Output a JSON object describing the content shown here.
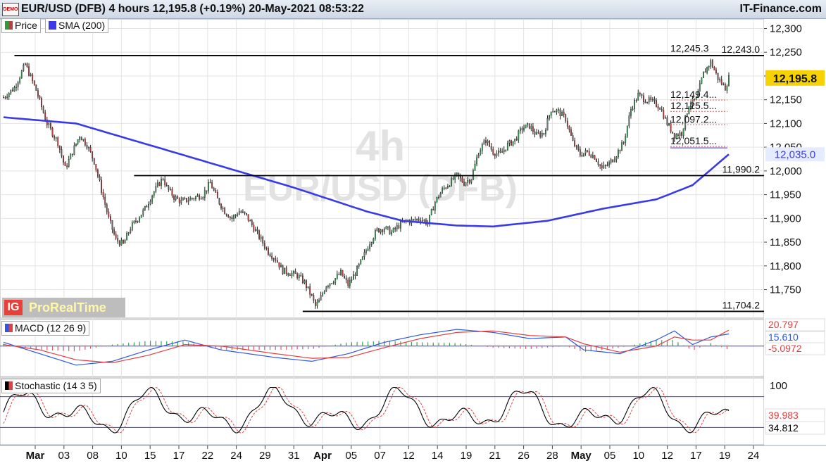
{
  "header": {
    "title": "EUR/USD (DFB) 4 hours 12,195.8 (+0.19%) 20-May-2021 08:53:22",
    "brand": "IT-Finance.com",
    "demo_icon_text": "DEMO"
  },
  "legend": {
    "price_label": "Price",
    "sma_label": "SMA (200)",
    "price_color": "#2e9e3a",
    "sma_color": "#3a3ae8"
  },
  "watermark": {
    "line1": "4h",
    "line2": "EUR/USD (DFB)"
  },
  "logo": {
    "ig": "IG",
    "text": "ProRealTime"
  },
  "colors": {
    "up_candle": "#3aa05a",
    "down_candle": "#b84040",
    "sma": "#3a3ae8",
    "current_price_bg": "#f5d200",
    "sma_label_bg": "#e6ecff",
    "grid": "#e4e4e4",
    "level_line": "#000000",
    "macd_line": "#2d58e0",
    "signal_line": "#e04040",
    "stoch_k": "#000000",
    "stoch_d": "#e04040"
  },
  "chart_data": [
    {
      "type": "candlestick",
      "title": "EUR/USD (DFB) 4 hours",
      "ylim": [
        11690,
        12320
      ],
      "y_ticks": [
        12300,
        12250,
        12200,
        12150,
        12100,
        12050,
        12000,
        11950,
        11900,
        11850,
        11800,
        11750
      ],
      "y_tick_labels": [
        "12,300",
        "12,250",
        "12,200",
        "12,150",
        "12,100",
        "12,050",
        "12,000",
        "11,950",
        "11,900",
        "11,850",
        "11,800",
        "11,750"
      ],
      "x_ticks": [
        {
          "label": "Mar",
          "bold": true
        },
        {
          "label": "03"
        },
        {
          "label": "08"
        },
        {
          "label": "10"
        },
        {
          "label": "15"
        },
        {
          "label": "17"
        },
        {
          "label": "22"
        },
        {
          "label": "24"
        },
        {
          "label": "29"
        },
        {
          "label": "31"
        },
        {
          "label": "Apr",
          "bold": true
        },
        {
          "label": "05"
        },
        {
          "label": "07"
        },
        {
          "label": "12"
        },
        {
          "label": "14"
        },
        {
          "label": "19"
        },
        {
          "label": "21"
        },
        {
          "label": "26"
        },
        {
          "label": "28"
        },
        {
          "label": "May",
          "bold": true
        },
        {
          "label": "05"
        },
        {
          "label": "10"
        },
        {
          "label": "12"
        },
        {
          "label": "17"
        },
        {
          "label": "19"
        },
        {
          "label": "24"
        }
      ],
      "close_path": [
        [
          0,
          12155
        ],
        [
          6,
          12175
        ],
        [
          12,
          12225
        ],
        [
          18,
          12170
        ],
        [
          24,
          12100
        ],
        [
          30,
          12060
        ],
        [
          34,
          12005
        ],
        [
          38,
          12040
        ],
        [
          42,
          12075
        ],
        [
          46,
          12055
        ],
        [
          50,
          12020
        ],
        [
          54,
          11960
        ],
        [
          58,
          11900
        ],
        [
          62,
          11855
        ],
        [
          66,
          11845
        ],
        [
          70,
          11880
        ],
        [
          74,
          11900
        ],
        [
          78,
          11920
        ],
        [
          82,
          11950
        ],
        [
          86,
          11975
        ],
        [
          88,
          11985
        ],
        [
          90,
          11965
        ],
        [
          94,
          11945
        ],
        [
          98,
          11935
        ],
        [
          102,
          11940
        ],
        [
          106,
          11945
        ],
        [
          110,
          11950
        ],
        [
          114,
          11975
        ],
        [
          118,
          11940
        ],
        [
          122,
          11915
        ],
        [
          126,
          11900
        ],
        [
          130,
          11915
        ],
        [
          134,
          11905
        ],
        [
          138,
          11880
        ],
        [
          142,
          11855
        ],
        [
          146,
          11830
        ],
        [
          150,
          11815
        ],
        [
          154,
          11790
        ],
        [
          158,
          11785
        ],
        [
          162,
          11780
        ],
        [
          166,
          11765
        ],
        [
          170,
          11735
        ],
        [
          172,
          11715
        ],
        [
          174,
          11725
        ],
        [
          178,
          11760
        ],
        [
          182,
          11770
        ],
        [
          186,
          11785
        ],
        [
          190,
          11760
        ],
        [
          194,
          11785
        ],
        [
          198,
          11815
        ],
        [
          202,
          11850
        ],
        [
          206,
          11875
        ],
        [
          210,
          11880
        ],
        [
          214,
          11870
        ],
        [
          218,
          11885
        ],
        [
          222,
          11895
        ],
        [
          226,
          11895
        ],
        [
          230,
          11900
        ],
        [
          234,
          11890
        ],
        [
          238,
          11935
        ],
        [
          242,
          11960
        ],
        [
          246,
          11975
        ],
        [
          250,
          11990
        ],
        [
          254,
          11975
        ],
        [
          258,
          11985
        ],
        [
          262,
          12040
        ],
        [
          266,
          12065
        ],
        [
          270,
          12040
        ],
        [
          274,
          12035
        ],
        [
          278,
          12055
        ],
        [
          282,
          12065
        ],
        [
          286,
          12090
        ],
        [
          290,
          12095
        ],
        [
          294,
          12075
        ],
        [
          298,
          12080
        ],
        [
          302,
          12130
        ],
        [
          306,
          12125
        ],
        [
          310,
          12110
        ],
        [
          314,
          12060
        ],
        [
          318,
          12035
        ],
        [
          322,
          12040
        ],
        [
          326,
          12030
        ],
        [
          330,
          12005
        ],
        [
          334,
          12015
        ],
        [
          338,
          12035
        ],
        [
          342,
          12060
        ],
        [
          346,
          12130
        ],
        [
          350,
          12160
        ],
        [
          354,
          12150
        ],
        [
          358,
          12145
        ],
        [
          362,
          12135
        ],
        [
          366,
          12100
        ],
        [
          370,
          12075
        ],
        [
          374,
          12080
        ],
        [
          378,
          12140
        ],
        [
          382,
          12150
        ],
        [
          386,
          12205
        ],
        [
          390,
          12230
        ],
        [
          394,
          12195
        ],
        [
          398,
          12175
        ],
        [
          400,
          12196
        ]
      ],
      "series": [
        {
          "name": "Price",
          "current": 12195.8,
          "current_label": "12,195.8"
        },
        {
          "name": "SMA (200)",
          "current": 12035.0,
          "current_label": "12,035.0",
          "path": [
            [
              0,
              12113
            ],
            [
              40,
              12100
            ],
            [
              80,
              12055
            ],
            [
              120,
              12010
            ],
            [
              160,
              11965
            ],
            [
              200,
              11915
            ],
            [
              220,
              11895
            ],
            [
              250,
              11885
            ],
            [
              270,
              11883
            ],
            [
              300,
              11895
            ],
            [
              330,
              11920
            ],
            [
              360,
              11940
            ],
            [
              380,
              11970
            ],
            [
              400,
              12035
            ]
          ]
        }
      ],
      "levels": [
        {
          "value": 12243.0,
          "label": "12,243.0"
        },
        {
          "value": 11990.2,
          "label": "11,990.2"
        },
        {
          "value": 11704.2,
          "label": "11,704.2"
        }
      ],
      "fib_levels": [
        {
          "value": 12245.3,
          "label": "12,245.3"
        },
        {
          "value": 12149.4,
          "label": "12,149.4..."
        },
        {
          "value": 12125.5,
          "label": "12,125.5..."
        },
        {
          "value": 12097.2,
          "label": "12,097.2..."
        },
        {
          "value": 12051.5,
          "label": "12,051.5..."
        }
      ]
    },
    {
      "type": "line",
      "title": "MACD (12 26 9)",
      "ylim": [
        -40,
        35
      ],
      "values": [
        {
          "label": "20.797",
          "value": 20.797,
          "color": "#e04040"
        },
        {
          "label": "15.610",
          "value": 15.61,
          "color": "#2d58e0"
        },
        {
          "label": "-5.0972",
          "value": -5.0972,
          "color": "#e04040"
        }
      ],
      "macd_path": [
        [
          0,
          5
        ],
        [
          20,
          -10
        ],
        [
          40,
          -25
        ],
        [
          60,
          -20
        ],
        [
          80,
          -5
        ],
        [
          100,
          8
        ],
        [
          120,
          -5
        ],
        [
          150,
          -15
        ],
        [
          170,
          -20
        ],
        [
          190,
          -10
        ],
        [
          210,
          5
        ],
        [
          230,
          15
        ],
        [
          250,
          22
        ],
        [
          270,
          18
        ],
        [
          290,
          10
        ],
        [
          310,
          12
        ],
        [
          320,
          -5
        ],
        [
          340,
          -10
        ],
        [
          360,
          8
        ],
        [
          370,
          20
        ],
        [
          380,
          2
        ],
        [
          390,
          12
        ],
        [
          400,
          16
        ]
      ],
      "signal_path": [
        [
          0,
          2
        ],
        [
          20,
          -5
        ],
        [
          40,
          -18
        ],
        [
          60,
          -22
        ],
        [
          80,
          -12
        ],
        [
          100,
          2
        ],
        [
          120,
          0
        ],
        [
          150,
          -10
        ],
        [
          170,
          -16
        ],
        [
          190,
          -15
        ],
        [
          210,
          -2
        ],
        [
          230,
          10
        ],
        [
          250,
          18
        ],
        [
          270,
          20
        ],
        [
          290,
          14
        ],
        [
          310,
          12
        ],
        [
          320,
          3
        ],
        [
          340,
          -8
        ],
        [
          360,
          0
        ],
        [
          370,
          12
        ],
        [
          380,
          8
        ],
        [
          390,
          8
        ],
        [
          400,
          21
        ]
      ]
    },
    {
      "type": "line",
      "title": "Stochastic (14 3 5)",
      "ylim": [
        0,
        100
      ],
      "y_ticks": [
        100
      ],
      "y_tick_labels": [
        "100"
      ],
      "bands": [
        80,
        20
      ],
      "values": [
        {
          "label": "39.983",
          "value": 39.983,
          "color": "#e04040"
        },
        {
          "label": "34.812",
          "value": 34.812,
          "color": "#000000"
        }
      ]
    }
  ]
}
